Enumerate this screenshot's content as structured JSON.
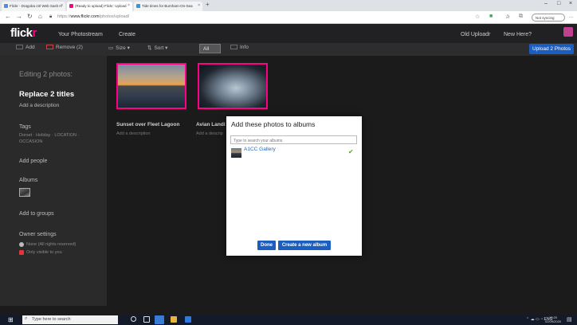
{
  "browser": {
    "tabs": [
      {
        "label": "Flickr - Dragoba ctrl Web Sash H"
      },
      {
        "label": "(Ready to upload) Flickr: Upload"
      },
      {
        "label": "Tide times for Burnham-On-Sea"
      }
    ],
    "url_prefix": "https://",
    "url_domain": "www.flickr.com",
    "url_path": "/photos/upload/",
    "not_syncing": "Not syncing"
  },
  "header": {
    "logo_prefix": "flick",
    "logo_suffix": "r",
    "nav": [
      "Your Photostream",
      "Create"
    ],
    "old_uploadr": "Old Uploadr",
    "new_here": "New Here?"
  },
  "toolbar": {
    "add": "Add",
    "remove": "Remove (2)",
    "size": "Size ▾",
    "sort": "Sort ▾",
    "all": "All",
    "info": "Info",
    "upload": "Upload 2 Photos"
  },
  "sidebar": {
    "editing": "Editing 2 photos:",
    "replace_titles": "Replace 2 titles",
    "add_description": "Add a description",
    "tags_label": "Tags",
    "tags_value": "Dorset · Holiday · LOCATION · OCCASION",
    "add_people": "Add people",
    "albums": "Albums",
    "add_groups": "Add to groups",
    "owner_settings": "Owner settings",
    "license": "None (All rights reserved)",
    "privacy": "Only visible to you"
  },
  "photos": [
    {
      "title": "Sunset over Fleet Lagoon",
      "description": "Add a description"
    },
    {
      "title": "Avian Landi",
      "description": "Add a descrip"
    }
  ],
  "modal": {
    "title": "Add these photos to albums",
    "search_placeholder": "Type to search your albums",
    "album": "A1CC Gallery",
    "done": "Done",
    "create": "Create a new album"
  },
  "taskbar": {
    "search_placeholder": "Type here to search",
    "tray": "ENG",
    "time": "19:20",
    "date": "02/09/2020"
  },
  "colors": {
    "flickr_pink": "#ff0084",
    "primary_blue": "#1b5ebf",
    "check_green": "#55a336"
  }
}
